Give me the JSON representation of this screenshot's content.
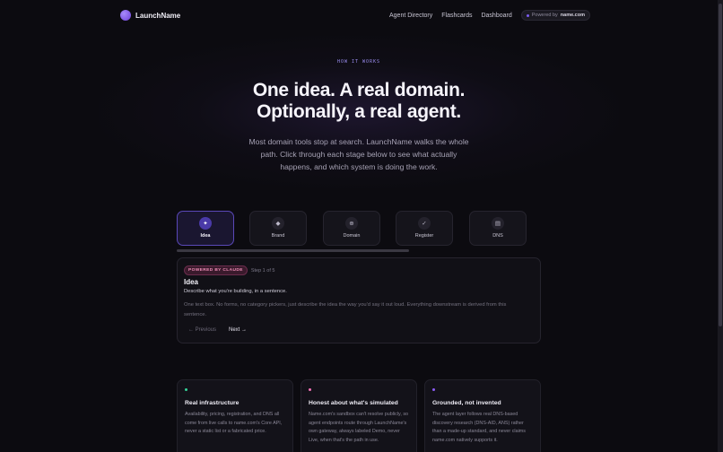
{
  "brand": {
    "name": "LaunchName"
  },
  "nav": {
    "items": [
      "Agent Directory",
      "Flashcards",
      "Dashboard"
    ],
    "powered_prefix": "Powered by",
    "powered_name": "name.com"
  },
  "hero": {
    "eyebrow": "HOW IT WORKS",
    "title_line1": "One idea. A real domain.",
    "title_line2": "Optionally, a real agent.",
    "description": "Most domain tools stop at search. LaunchName walks the whole path. Click through each stage below to see what actually happens, and which system is doing the work."
  },
  "steps": [
    {
      "label": "Idea",
      "icon": "sparkle-icon",
      "glyph": "✦",
      "active": true
    },
    {
      "label": "Brand",
      "icon": "diamond-icon",
      "glyph": "◆",
      "active": false
    },
    {
      "label": "Domain",
      "icon": "globe-icon",
      "glyph": "⊕",
      "active": false
    },
    {
      "label": "Register",
      "icon": "check-icon",
      "glyph": "✓",
      "active": false
    },
    {
      "label": "DNS",
      "icon": "server-icon",
      "glyph": "▤",
      "active": false
    }
  ],
  "detail": {
    "badge": "POWERED BY CLAUDE",
    "step_count": "Step 1 of 5",
    "title": "Idea",
    "subtitle": "Describe what you're building, in a sentence.",
    "body": "One text box. No forms, no category pickers, just describe the idea the way you'd say it out loud. Everything downstream is derived from this sentence.",
    "prev_label": "← Previous",
    "next_label": "Next →"
  },
  "features": [
    {
      "title": "Real infrastructure",
      "body": "Availability, pricing, registration, and DNS all come from live calls to name.com's Core API, never a static list or a fabricated price.",
      "color": "#34d399"
    },
    {
      "title": "Honest about what's simulated",
      "body": "Name.com's sandbox can't resolve publicly, so agent endpoints route through LaunchName's own gateway, always labeled Demo, never Live, when that's the path in use.",
      "color": "#f472b6"
    },
    {
      "title": "Grounded, not invented",
      "body": "The agent layer follows real DNS-based discovery research (DNS-AID, ANS) rather than a made-up standard, and never claims name.com natively supports it.",
      "color": "#8b5cf6"
    }
  ]
}
